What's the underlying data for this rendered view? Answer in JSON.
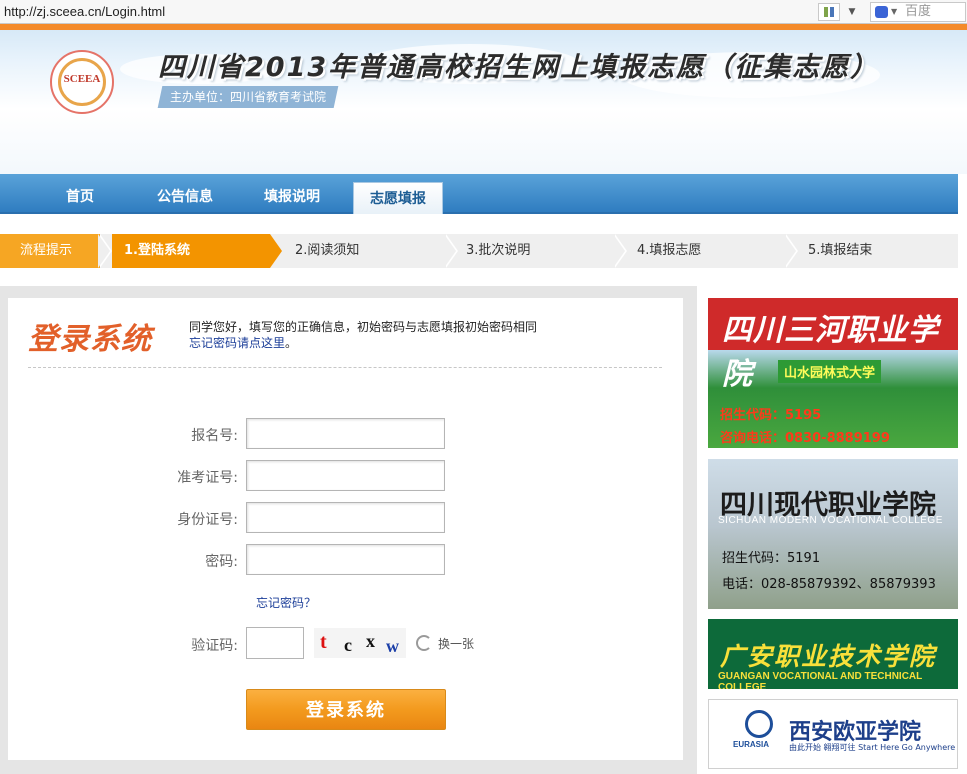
{
  "browser": {
    "url": "http://zj.sceea.cn/Login.html",
    "search_placeholder": "百度"
  },
  "header": {
    "logo_text": "SCEEA",
    "title": "四川省2013年普通高校招生网上填报志愿（征集志愿）",
    "sponsor": "主办单位：四川省教育考试院"
  },
  "nav": {
    "items": [
      {
        "label": "首页"
      },
      {
        "label": "公告信息"
      },
      {
        "label": "填报说明"
      },
      {
        "label": "志愿填报"
      }
    ],
    "active_index": 3
  },
  "steps": {
    "items": [
      {
        "label": "流程提示"
      },
      {
        "label": "1.登陆系统"
      },
      {
        "label": "2.阅读须知"
      },
      {
        "label": "3.批次说明"
      },
      {
        "label": "4.填报志愿"
      },
      {
        "label": "5.填报结束"
      }
    ],
    "current_index": 1
  },
  "login": {
    "title": "登录系统",
    "intro_line1": "同学您好，填写您的正确信息，初始密码与志愿填报初始密码相同",
    "intro_link": "忘记密码请点这里",
    "intro_end": "。",
    "fields": [
      {
        "label": "报名号:",
        "value": ""
      },
      {
        "label": "准考证号:",
        "value": ""
      },
      {
        "label": "身份证号:",
        "value": ""
      },
      {
        "label": "密码:",
        "value": ""
      }
    ],
    "forgot_link": "忘记密码？",
    "captcha_label": "验证码:",
    "captcha_value": "",
    "captcha_chars": [
      "t",
      "c",
      "x",
      "w"
    ],
    "refresh_label": "换一张",
    "submit_label": "登录系统"
  },
  "ads": [
    {
      "name": "四川三河职业学院",
      "subtitle": "山水园林式大学",
      "line1": "招生代码：5195",
      "line2": "咨询电话：0830-8889199"
    },
    {
      "name": "四川现代职业学院",
      "english": "SICHUAN MODERN VOCATIONAL COLLEGE",
      "line1": "招生代码：5191",
      "line2": "电话：028-85879392、85879393"
    },
    {
      "name": "广安职业技术学院",
      "english": "GUANGAN VOCATIONAL AND TECHNICAL COLLEGE"
    },
    {
      "name": "西安欧亚学院",
      "logo_text": "EURASIA",
      "slogan": "由此开始 翱翔可往 Start Here Go Anywhere"
    }
  ],
  "colors": {
    "nav_blue": "#2f7dc0",
    "step_orange": "#f39400",
    "button_orange": "#f39a1e",
    "title_orange": "#e2602a",
    "link_blue": "#1d3f99"
  }
}
